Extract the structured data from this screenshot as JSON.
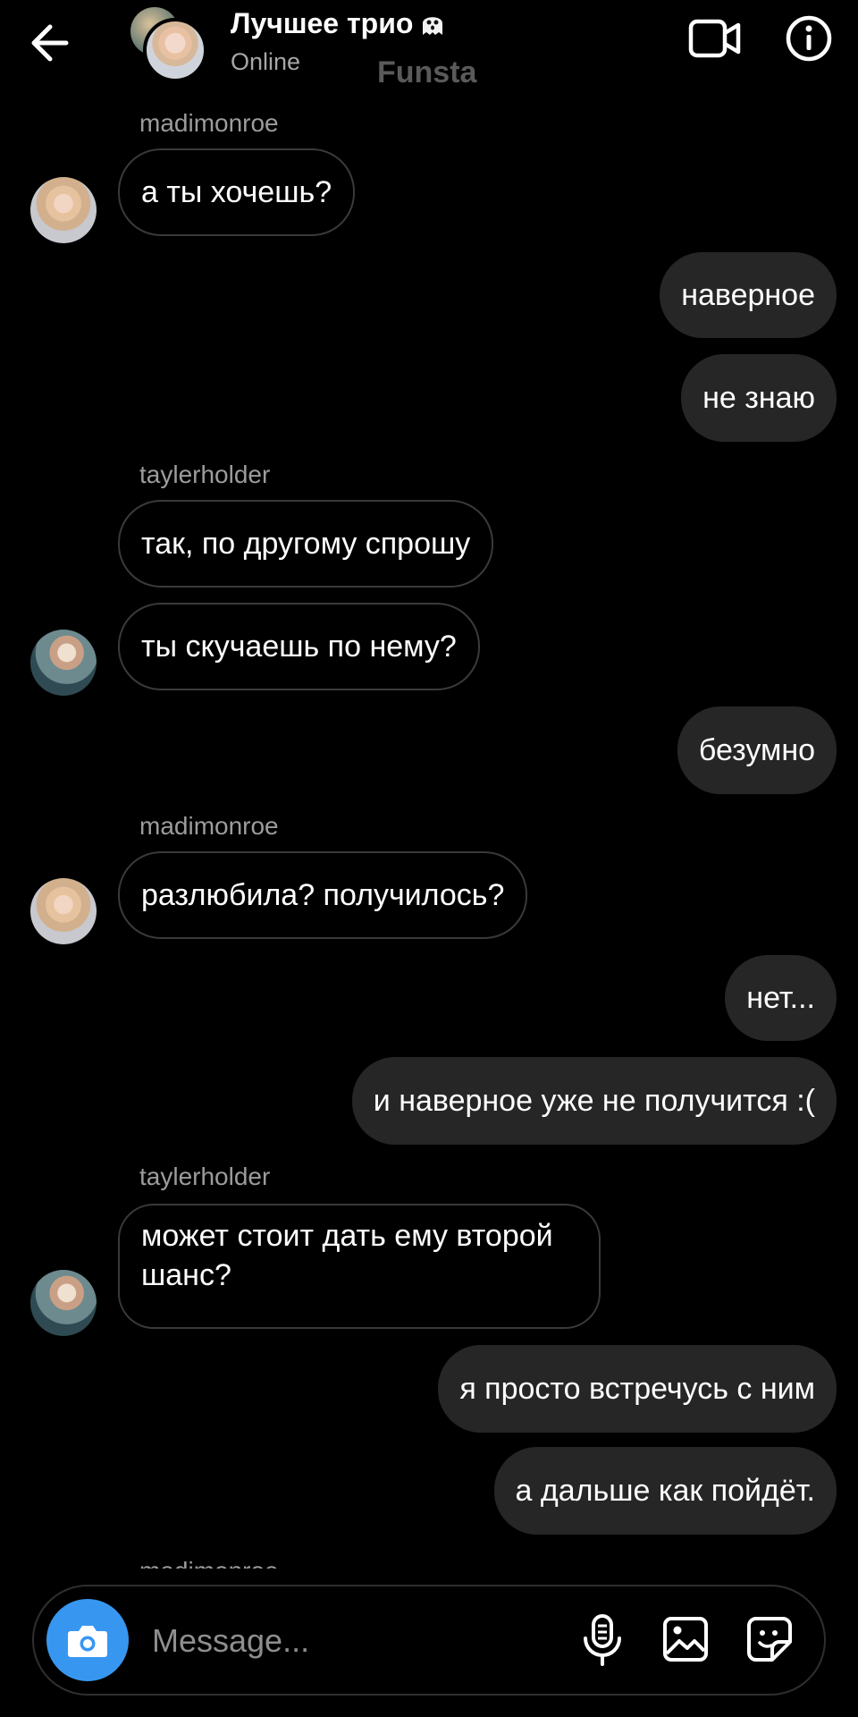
{
  "header": {
    "title": "Лучшее трио",
    "status": "Online",
    "account_label": "Funsta"
  },
  "messages": [
    {
      "sender": "madimonroe"
    },
    {
      "text": "а ты хочешь?"
    },
    {
      "text": "наверное"
    },
    {
      "text": "не знаю"
    },
    {
      "sender": "taylerholder"
    },
    {
      "text": "так, по другому спрошу"
    },
    {
      "text": "ты скучаешь по нему?"
    },
    {
      "text": "безумно"
    },
    {
      "sender": "madimonroe"
    },
    {
      "text": "разлюбила? получилось?"
    },
    {
      "text": "нет..."
    },
    {
      "text": "и наверное уже не получится :("
    },
    {
      "sender": "taylerholder"
    },
    {
      "text": "может стоит дать ему второй шанс?"
    },
    {
      "text": "я просто встречусь с ним"
    },
    {
      "text": "а дальше как пойдёт."
    },
    {
      "sender": "madimonroe"
    }
  ],
  "composer": {
    "placeholder": "Message..."
  },
  "colors": {
    "background": "#000000",
    "outgoing_bubble": "#262626",
    "camera_button": "#3797f0"
  }
}
